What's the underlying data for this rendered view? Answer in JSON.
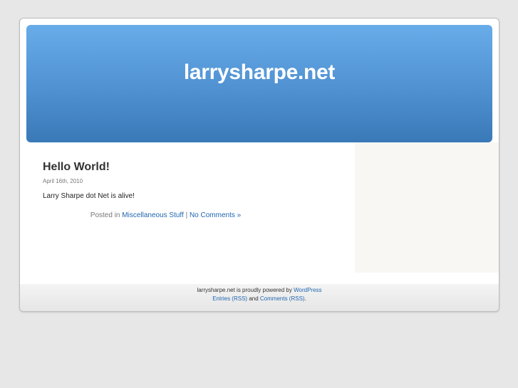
{
  "header": {
    "title": "larrysharpe.net"
  },
  "post": {
    "title": "Hello World!",
    "date": "April 16th, 2010",
    "body": "Larry Sharpe dot Net is alive!",
    "meta_prefix": "Posted in ",
    "category": "Miscellaneous Stuff",
    "separator": " | ",
    "comments_link": "No Comments »"
  },
  "footer": {
    "powered_text": "larrysharpe.net is proudly powered by ",
    "wordpress_link": "WordPress",
    "entries_rss": "Entries (RSS)",
    "and_text": " and ",
    "comments_rss": "Comments (RSS)",
    "end_period": "."
  },
  "colors": {
    "link": "#2066b0",
    "header_top": "#69acea",
    "header_bottom": "#3a79b8",
    "background": "#e7e7e7"
  }
}
